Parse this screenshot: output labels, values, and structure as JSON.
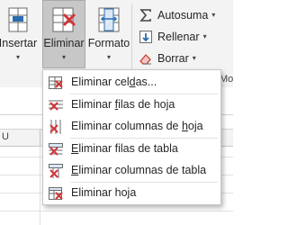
{
  "ribbon": {
    "insertar": {
      "label": "Insertar",
      "caret": "▾"
    },
    "eliminar": {
      "label": "Eliminar",
      "caret": "▾"
    },
    "formato": {
      "label": "Formato",
      "caret": "▾"
    },
    "autosuma": {
      "label": "Autosuma",
      "caret": "▾"
    },
    "rellenar": {
      "label": "Rellenar",
      "caret": "▾"
    },
    "borrar": {
      "label": "Borrar",
      "caret": "▾"
    },
    "group_cut_label": "Mo"
  },
  "sheet": {
    "column_header_cut": "U"
  },
  "menu": {
    "items": [
      {
        "pre": "Eliminar cel",
        "key": "d",
        "post": "as...",
        "icon": "delete-cells-icon"
      },
      {
        "pre": "Eliminar ",
        "key": "f",
        "post": "ilas de hoja",
        "icon": "delete-sheet-rows-icon"
      },
      {
        "pre": "Eliminar columnas de ",
        "key": "h",
        "post": "oja",
        "icon": "delete-sheet-columns-icon"
      },
      {
        "pre": "",
        "key": "E",
        "post": "liminar filas de tabla",
        "icon": "delete-table-rows-icon"
      },
      {
        "pre": "",
        "key": "E",
        "post": "liminar columnas de tabla",
        "icon": "delete-table-columns-icon"
      },
      {
        "pre": "Eliminar ho",
        "key": "j",
        "post": "a",
        "icon": "delete-sheet-icon"
      }
    ]
  },
  "colors": {
    "ribbon_bg": "#f3f3f3",
    "pressed_bg": "#c7c7c7",
    "delete_red": "#d13438",
    "icon_gray": "#555555",
    "icon_blue": "#2b6cb0"
  }
}
